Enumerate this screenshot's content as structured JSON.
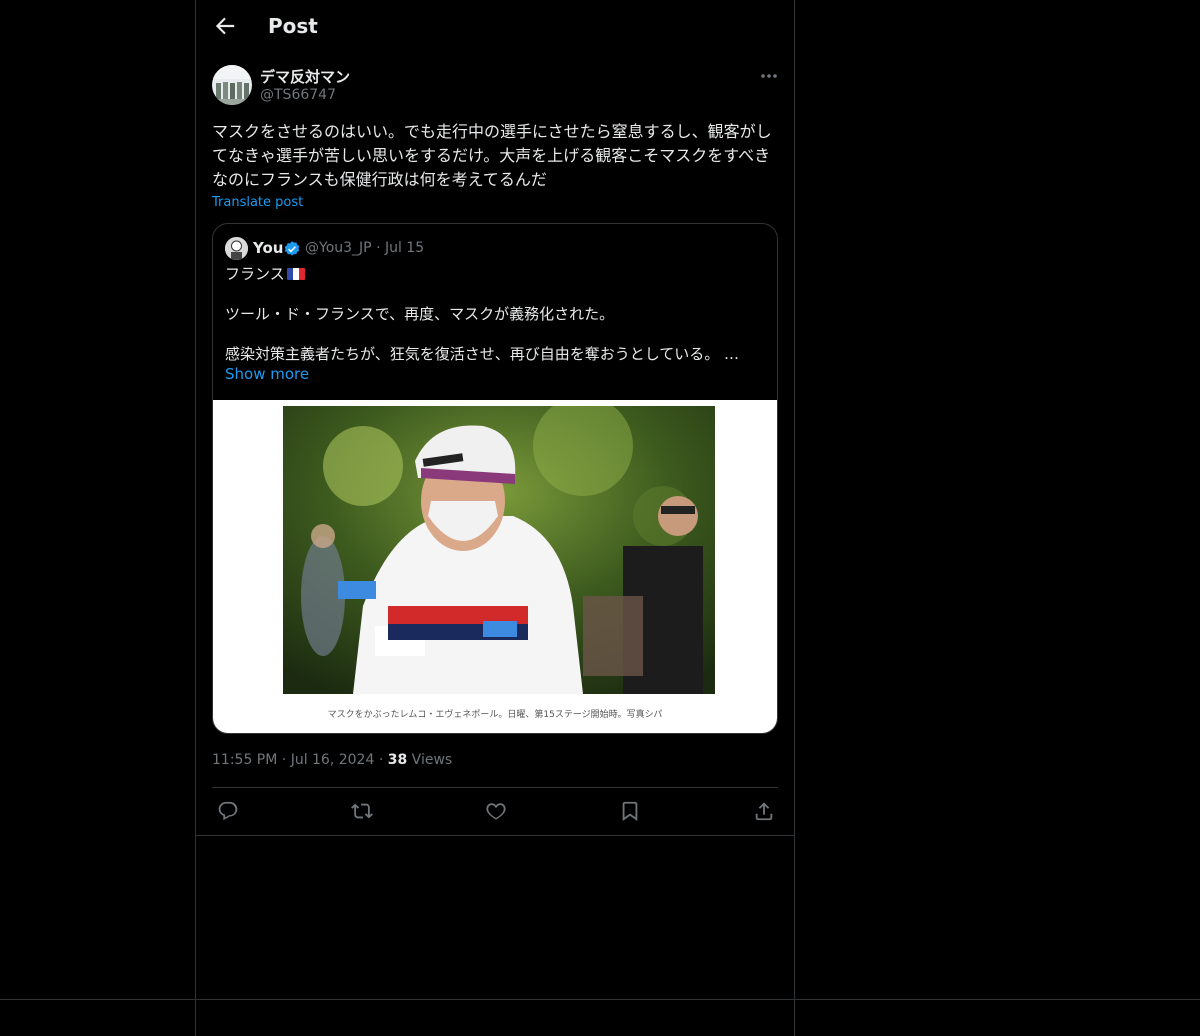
{
  "header": {
    "title": "Post"
  },
  "post": {
    "author_name": "デマ反対マン",
    "author_handle": "@TS66747",
    "text": "マスクをさせるのはいい。でも走行中の選手にさせたら窒息するし、観客がしてなきゃ選手が苦しい思いをするだけ。大声を上げる観客こそマスクをすべきなのにフランスも保健行政は何を考えてるんだ",
    "translate_label": "Translate post",
    "time": "11:55 PM",
    "date": "Jul 16, 2024",
    "views_count": "38",
    "views_label": "Views"
  },
  "quote": {
    "author_name": "You",
    "author_handle": "@You3_JP",
    "date": "Jul 15",
    "line1": "フランス",
    "line2": "ツール・ド・フランスで、再度、マスクが義務化された。",
    "line3": "感染対策主義者たちが、狂気を復活させ、再び自由を奪おうとしている。 …",
    "show_more": "Show more",
    "image_caption": "マスクをかぶったレムコ・エヴェネポール。日曜、第15ステージ開始時。写真シパ"
  },
  "colors": {
    "accent": "#1d9bf0",
    "muted": "#71767b",
    "border": "#2f3336",
    "background": "#000000"
  },
  "icons": [
    "back-arrow-icon",
    "more-icon",
    "verified-icon",
    "reply-icon",
    "repost-icon",
    "like-icon",
    "bookmark-icon",
    "share-icon"
  ]
}
